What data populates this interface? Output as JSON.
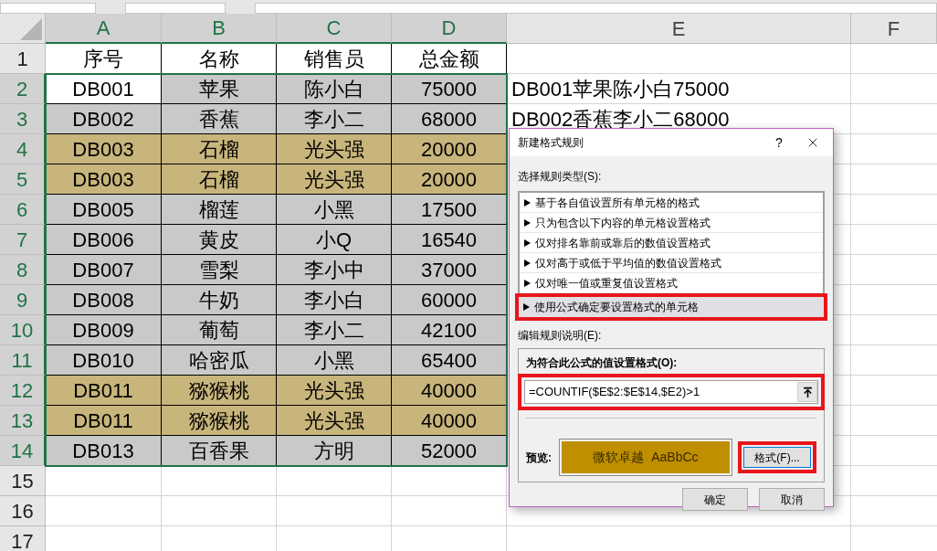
{
  "columns": [
    {
      "label": "A",
      "selected": true
    },
    {
      "label": "B",
      "selected": true
    },
    {
      "label": "C",
      "selected": true
    },
    {
      "label": "D",
      "selected": true
    },
    {
      "label": "E",
      "selected": false
    },
    {
      "label": "F",
      "selected": false
    }
  ],
  "rows": [
    {
      "number": "1",
      "selected": false,
      "cells": [
        {
          "text": "序号",
          "color": "#ffffff"
        },
        {
          "text": "名称",
          "color": "#ffffff"
        },
        {
          "text": "销售员",
          "color": "#ffffff"
        },
        {
          "text": "总金额",
          "color": "#ffffff"
        }
      ]
    },
    {
      "number": "2",
      "selected": true,
      "cells": [
        {
          "text": "DB001",
          "color": "#ffffff"
        },
        {
          "text": "苹果",
          "color": "#c9c9c9"
        },
        {
          "text": "陈小白",
          "color": "#c9c9c9"
        },
        {
          "text": "75000",
          "color": "#c9c9c9"
        }
      ],
      "e_text": "DB001苹果陈小白75000"
    },
    {
      "number": "3",
      "selected": true,
      "cells": [
        {
          "text": "DB002",
          "color": "#c9c9c9"
        },
        {
          "text": "香蕉",
          "color": "#c9c9c9"
        },
        {
          "text": "李小二",
          "color": "#c9c9c9"
        },
        {
          "text": "68000",
          "color": "#c9c9c9"
        }
      ],
      "e_text": "DB002香蕉李小二68000"
    },
    {
      "number": "4",
      "selected": true,
      "cells": [
        {
          "text": "DB003",
          "color": "#c8b57b"
        },
        {
          "text": "石榴",
          "color": "#c8b57b"
        },
        {
          "text": "光头强",
          "color": "#c8b57b"
        },
        {
          "text": "20000",
          "color": "#c8b57b"
        }
      ]
    },
    {
      "number": "5",
      "selected": true,
      "cells": [
        {
          "text": "DB003",
          "color": "#c8b57b"
        },
        {
          "text": "石榴",
          "color": "#c8b57b"
        },
        {
          "text": "光头强",
          "color": "#c8b57b"
        },
        {
          "text": "20000",
          "color": "#c8b57b"
        }
      ]
    },
    {
      "number": "6",
      "selected": true,
      "cells": [
        {
          "text": "DB005",
          "color": "#c9c9c9"
        },
        {
          "text": "榴莲",
          "color": "#c9c9c9"
        },
        {
          "text": "小黑",
          "color": "#c9c9c9"
        },
        {
          "text": "17500",
          "color": "#c9c9c9"
        }
      ]
    },
    {
      "number": "7",
      "selected": true,
      "cells": [
        {
          "text": "DB006",
          "color": "#c9c9c9"
        },
        {
          "text": "黄皮",
          "color": "#c9c9c9"
        },
        {
          "text": "小Q",
          "color": "#c9c9c9"
        },
        {
          "text": "16540",
          "color": "#c9c9c9"
        }
      ]
    },
    {
      "number": "8",
      "selected": true,
      "cells": [
        {
          "text": "DB007",
          "color": "#c9c9c9"
        },
        {
          "text": "雪梨",
          "color": "#c9c9c9"
        },
        {
          "text": "李小中",
          "color": "#c9c9c9"
        },
        {
          "text": "37000",
          "color": "#c9c9c9"
        }
      ]
    },
    {
      "number": "9",
      "selected": true,
      "cells": [
        {
          "text": "DB008",
          "color": "#c9c9c9"
        },
        {
          "text": "牛奶",
          "color": "#c9c9c9"
        },
        {
          "text": "李小白",
          "color": "#c9c9c9"
        },
        {
          "text": "60000",
          "color": "#c9c9c9"
        }
      ]
    },
    {
      "number": "10",
      "selected": true,
      "cells": [
        {
          "text": "DB009",
          "color": "#c9c9c9"
        },
        {
          "text": "葡萄",
          "color": "#c9c9c9"
        },
        {
          "text": "李小二",
          "color": "#c9c9c9"
        },
        {
          "text": "42100",
          "color": "#c9c9c9"
        }
      ]
    },
    {
      "number": "11",
      "selected": true,
      "cells": [
        {
          "text": "DB010",
          "color": "#c9c9c9"
        },
        {
          "text": "哈密瓜",
          "color": "#c9c9c9"
        },
        {
          "text": "小黑",
          "color": "#c9c9c9"
        },
        {
          "text": "65400",
          "color": "#c9c9c9"
        }
      ]
    },
    {
      "number": "12",
      "selected": true,
      "cells": [
        {
          "text": "DB011",
          "color": "#c8b57b"
        },
        {
          "text": "猕猴桃",
          "color": "#c8b57b"
        },
        {
          "text": "光头强",
          "color": "#c8b57b"
        },
        {
          "text": "40000",
          "color": "#c8b57b"
        }
      ]
    },
    {
      "number": "13",
      "selected": true,
      "cells": [
        {
          "text": "DB011",
          "color": "#c8b57b"
        },
        {
          "text": "猕猴桃",
          "color": "#c8b57b"
        },
        {
          "text": "光头强",
          "color": "#c8b57b"
        },
        {
          "text": "40000",
          "color": "#c8b57b"
        }
      ]
    },
    {
      "number": "14",
      "selected": true,
      "cells": [
        {
          "text": "DB013",
          "color": "#c9c9c9"
        },
        {
          "text": "百香果",
          "color": "#c9c9c9"
        },
        {
          "text": "方明",
          "color": "#c9c9c9"
        },
        {
          "text": "52000",
          "color": "#c9c9c9"
        }
      ]
    },
    {
      "number": "15",
      "selected": false,
      "cells": []
    },
    {
      "number": "16",
      "selected": false,
      "cells": []
    },
    {
      "number": "17",
      "selected": false,
      "cells": []
    }
  ],
  "dialog": {
    "title": "新建格式规则",
    "help": "?",
    "rule_type_label": "选择规则类型(S):",
    "rule_types": [
      {
        "label": "基于各自值设置所有单元格的格式",
        "selected": false,
        "annotated": false
      },
      {
        "label": "只为包含以下内容的单元格设置格式",
        "selected": false,
        "annotated": false
      },
      {
        "label": "仅对排名靠前或靠后的数值设置格式",
        "selected": false,
        "annotated": false
      },
      {
        "label": "仅对高于或低于平均值的数值设置格式",
        "selected": false,
        "annotated": false
      },
      {
        "label": "仅对唯一值或重复值设置格式",
        "selected": false,
        "annotated": false
      },
      {
        "label": "使用公式确定要设置格式的单元格",
        "selected": true,
        "annotated": true
      }
    ],
    "description_label": "编辑规则说明(E):",
    "formula_label": "为符合此公式的值设置格式(O):",
    "formula": {
      "value": "=COUNTIF($E$2:$E$14,$E2)>1",
      "annotated": true
    },
    "preview_label": "预览:",
    "preview_text": "微软卓越  AaBbCc",
    "format_button": {
      "label": "格式(F)...",
      "annotated": true
    },
    "ok": "确定",
    "cancel": "取消"
  }
}
